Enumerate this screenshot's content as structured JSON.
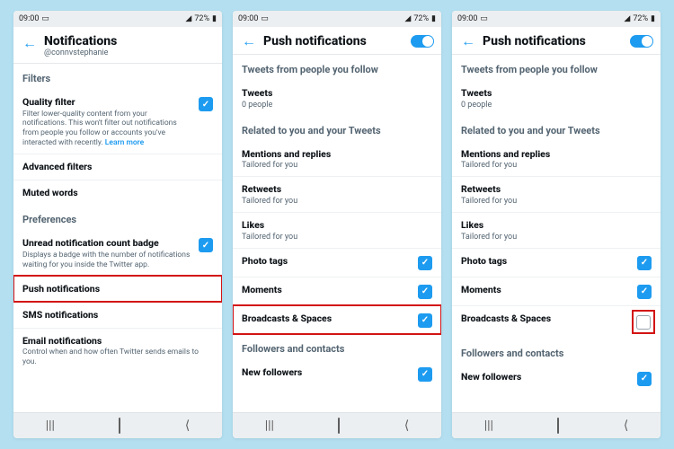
{
  "status": {
    "time": "09:00",
    "battery": "72%"
  },
  "screens": [
    {
      "header": {
        "title": "Notifications",
        "subtitle": "@connvstephanie"
      },
      "groups": [
        {
          "label": "Filters",
          "items": [
            {
              "title": "Quality filter",
              "desc": "Filter lower-quality content from your notifications. This won't filter out notifications from people you follow or accounts you've interacted with recently.",
              "link": "Learn more",
              "checked": true
            },
            {
              "title": "Advanced filters"
            },
            {
              "title": "Muted words"
            }
          ]
        },
        {
          "label": "Preferences",
          "items": [
            {
              "title": "Unread notification count badge",
              "desc": "Displays a badge with the number of notifications waiting for you inside the Twitter app.",
              "checked": true
            },
            {
              "title": "Push notifications",
              "highlight": true
            },
            {
              "title": "SMS notifications"
            },
            {
              "title": "Email notifications",
              "desc": "Control when and how often Twitter sends emails to you."
            }
          ]
        }
      ]
    },
    {
      "header": {
        "title": "Push notifications",
        "toggle_on": true
      },
      "groups": [
        {
          "label": "Tweets from people you follow",
          "items": [
            {
              "title": "Tweets",
              "sub": "0 people"
            }
          ]
        },
        {
          "label": "Related to you and your Tweets",
          "items": [
            {
              "title": "Mentions and replies",
              "sub": "Tailored for you"
            },
            {
              "title": "Retweets",
              "sub": "Tailored for you"
            },
            {
              "title": "Likes",
              "sub": "Tailored for you"
            },
            {
              "title": "Photo tags",
              "checked": true
            },
            {
              "title": "Moments",
              "checked": true
            },
            {
              "title": "Broadcasts & Spaces",
              "checked": true,
              "highlight": true
            }
          ]
        },
        {
          "label": "Followers and contacts",
          "items": [
            {
              "title": "New followers",
              "checked": true
            }
          ]
        }
      ]
    },
    {
      "header": {
        "title": "Push notifications",
        "toggle_on": true
      },
      "groups": [
        {
          "label": "Tweets from people you follow",
          "items": [
            {
              "title": "Tweets",
              "sub": "0 people"
            }
          ]
        },
        {
          "label": "Related to you and your Tweets",
          "items": [
            {
              "title": "Mentions and replies",
              "sub": "Tailored for you"
            },
            {
              "title": "Retweets",
              "sub": "Tailored for you"
            },
            {
              "title": "Likes",
              "sub": "Tailored for you"
            },
            {
              "title": "Photo tags",
              "checked": true
            },
            {
              "title": "Moments",
              "checked": true
            },
            {
              "title": "Broadcasts & Spaces",
              "checked": false,
              "checkbox_highlight": true
            }
          ]
        },
        {
          "label": "Followers and contacts",
          "items": [
            {
              "title": "New followers",
              "checked": true
            }
          ]
        }
      ]
    }
  ]
}
